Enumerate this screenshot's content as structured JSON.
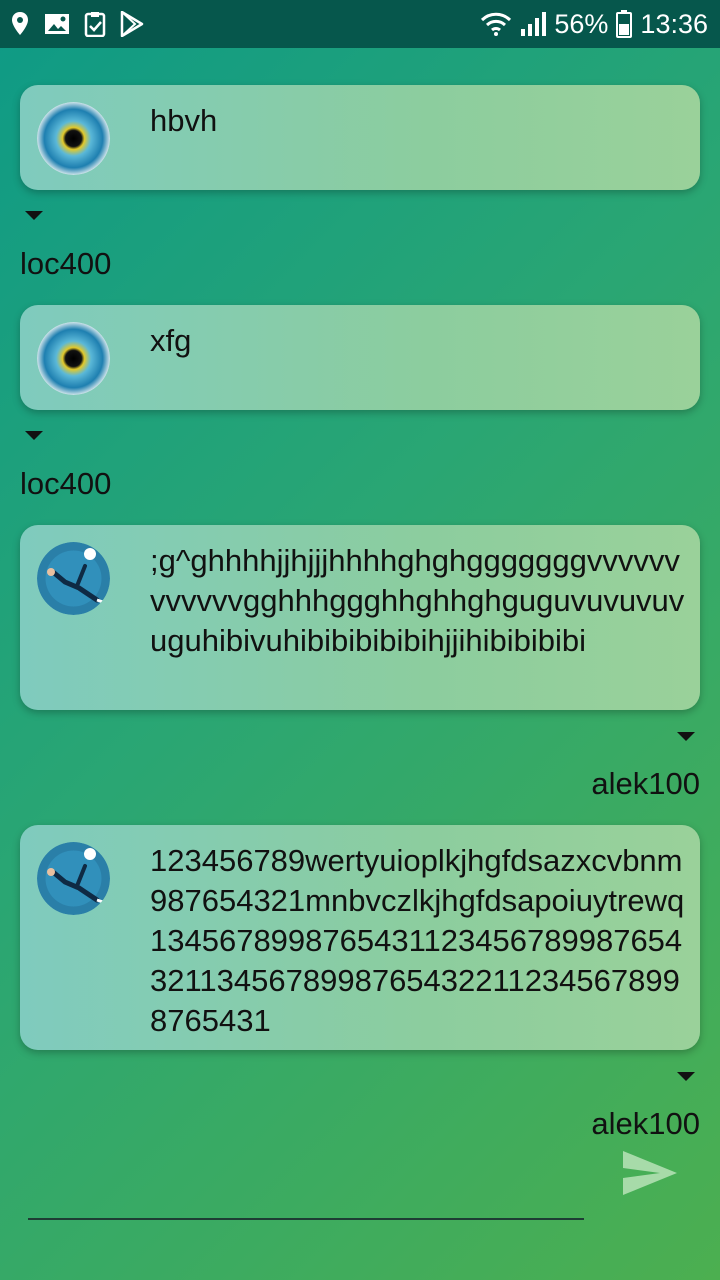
{
  "status_bar": {
    "battery": "56%",
    "time": "13:36",
    "left_icons": [
      "location-icon",
      "image-icon",
      "clipboard-check-icon",
      "play-store-icon"
    ],
    "right_icons": [
      "wifi-icon",
      "signal-icon",
      "battery-icon"
    ]
  },
  "chat": {
    "clipped_top_sender": "loc400",
    "messages": [
      {
        "text": "hbvh",
        "sender": "loc400",
        "avatar": "eye-avatar",
        "side": "left"
      },
      {
        "text": "xfg",
        "sender": "loc400",
        "avatar": "eye-avatar",
        "side": "left"
      },
      {
        "text": ";g^ghhhhjjhjjjhhhhghghgggggggvvvvvvvvvvvvgghhhggghhghhghguguvuvuvuvuguhibivuhibibibibibihjjihibibibibi",
        "sender": "alek100",
        "avatar": "soccer-player-avatar",
        "side": "right"
      },
      {
        "text": "123456789wertyuioplkjhgfdsazxcvbnm987654321mnbvczlkjhgfdsapoiuytrewq134567899876543112345678998765432113456789987654322112345678998765431",
        "sender": "alek100",
        "avatar": "soccer-player-avatar",
        "side": "right"
      }
    ]
  },
  "composer": {
    "value": "",
    "placeholder": "",
    "send_icon": "send-icon"
  },
  "colors": {
    "status_bar_bg": "#06574c",
    "bubble_start": "#7fcbbe",
    "bubble_end": "#9ad19a",
    "send_icon": "#a7dba9"
  }
}
